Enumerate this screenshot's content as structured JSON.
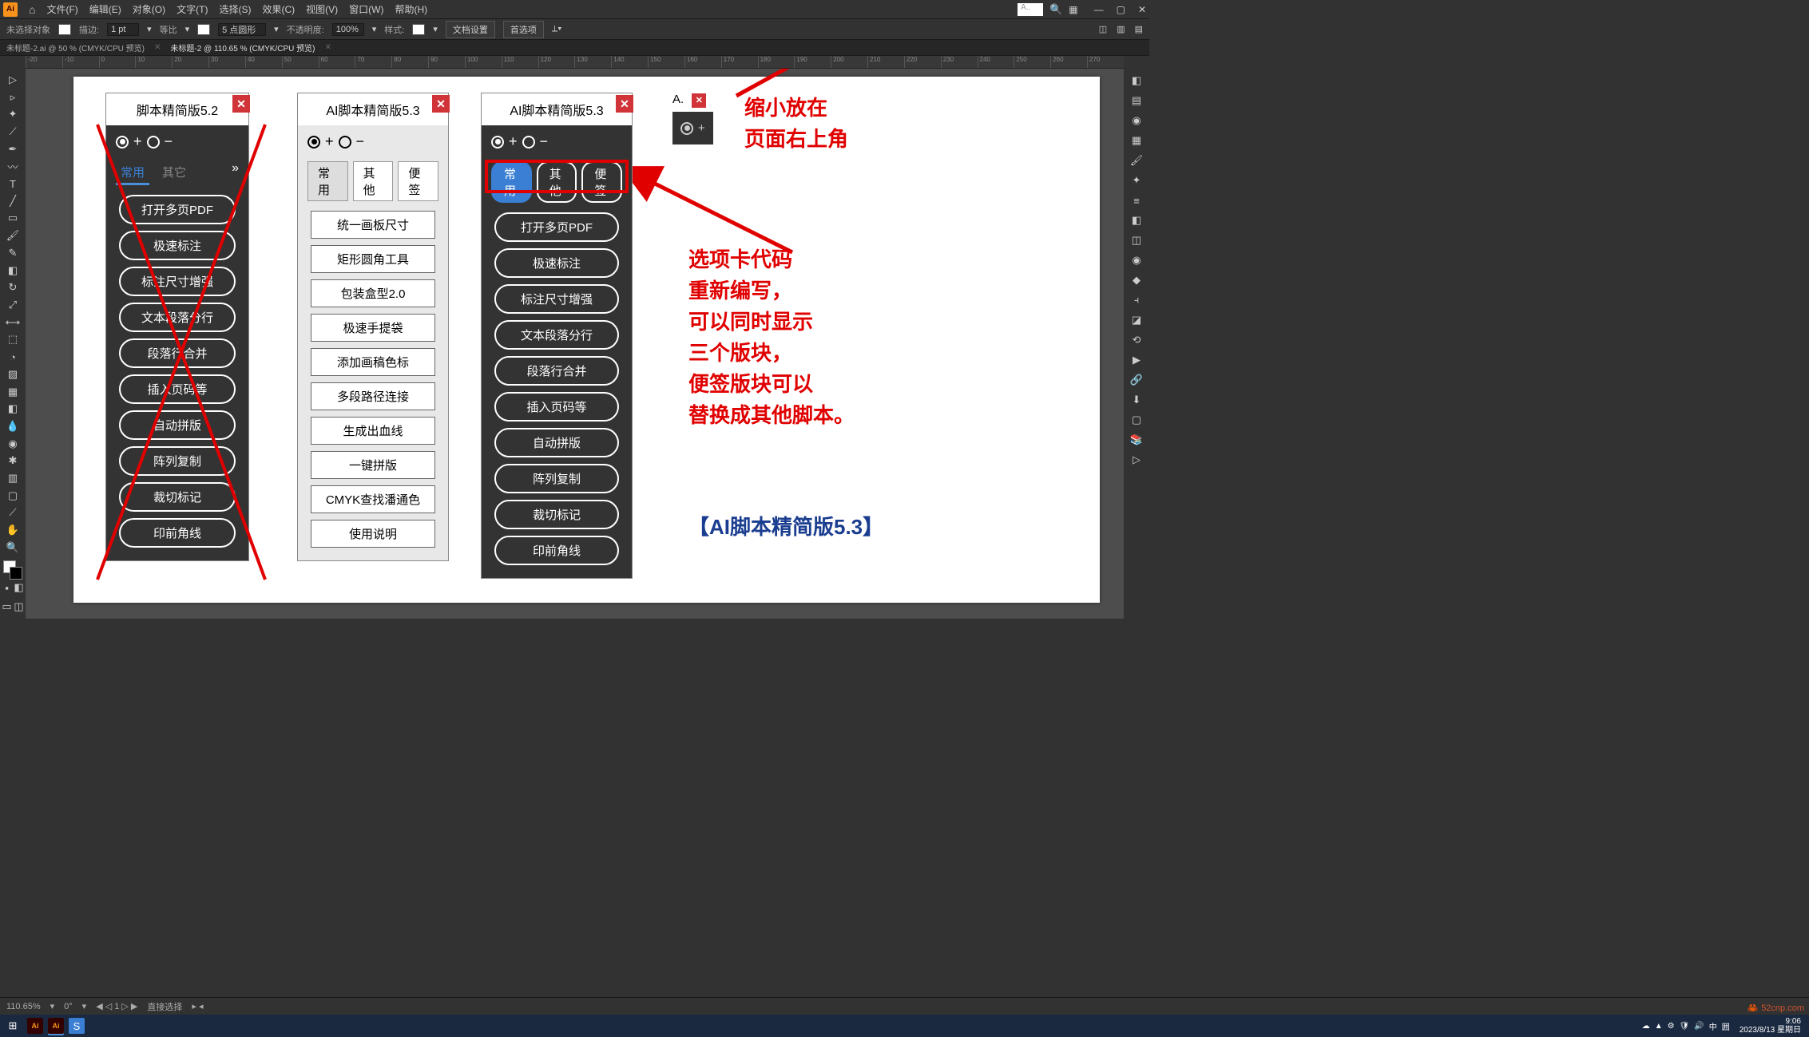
{
  "menubar": [
    "文件(F)",
    "编辑(E)",
    "对象(O)",
    "文字(T)",
    "选择(S)",
    "效果(C)",
    "视图(V)",
    "窗口(W)",
    "帮助(H)"
  ],
  "controlbar": {
    "no_selection": "未选择对象",
    "stroke_label": "描边:",
    "stroke_val": "1 pt",
    "uniform": "等比",
    "brush_val": "5 点圆形",
    "opacity_label": "不透明度:",
    "opacity_val": "100%",
    "style_label": "样式:",
    "doc_setup": "文档设置",
    "prefs": "首选项"
  },
  "doctabs": [
    "未标题-2.ai @ 50 % (CMYK/CPU 预览)",
    "未标题-2 @ 110.65 % (CMYK/CPU 预览)"
  ],
  "ruler_marks": [
    "-20",
    "-10",
    "0",
    "10",
    "20",
    "30",
    "40",
    "50",
    "60",
    "70",
    "80",
    "90",
    "100",
    "110",
    "120",
    "130",
    "140",
    "150",
    "160",
    "170",
    "180",
    "190",
    "200",
    "210",
    "220",
    "230",
    "240",
    "250",
    "260",
    "270"
  ],
  "panel52": {
    "title": "脚本精简版5.2",
    "tabs": [
      "常用",
      "其它"
    ],
    "buttons": [
      "打开多页PDF",
      "极速标注",
      "标注尺寸增强",
      "文本段落分行",
      "段落行合并",
      "插入页码等",
      "自动拼版",
      "阵列复制",
      "裁切标记",
      "印前角线"
    ]
  },
  "panel53_light": {
    "title": "AI脚本精简版5.3",
    "tabs": [
      "常用",
      "其他",
      "便签"
    ],
    "buttons": [
      "统一画板尺寸",
      "矩形圆角工具",
      "包装盒型2.0",
      "极速手提袋",
      "添加画稿色标",
      "多段路径连接",
      "生成出血线",
      "一键拼版",
      "CMYK查找潘通色",
      "使用说明"
    ]
  },
  "panel53_dark": {
    "title": "AI脚本精简版5.3",
    "tabs": [
      "常用",
      "其他",
      "便签"
    ],
    "buttons": [
      "打开多页PDF",
      "极速标注",
      "标注尺寸增强",
      "文本段落分行",
      "段落行合并",
      "插入页码等",
      "自动拼版",
      "阵列复制",
      "裁切标记",
      "印前角线"
    ]
  },
  "mini_panel_title": "A.",
  "annotations": {
    "top": "缩小放在\n页面右上角",
    "mid": "选项卡代码\n重新编写，\n可以同时显示\n三个版块，\n便签版块可以\n替换成其他脚本。",
    "bottom": "【AI脚本精简版5.3】"
  },
  "statusbar": {
    "zoom": "110.65%",
    "angle": "0°",
    "artboard": "1",
    "tool": "直接选择"
  },
  "taskbar": {
    "time": "9:06",
    "date": "2023/8/13 星期日"
  },
  "tray_text": "中",
  "search_placeholder": "A..",
  "watermark": "52cnp.com"
}
